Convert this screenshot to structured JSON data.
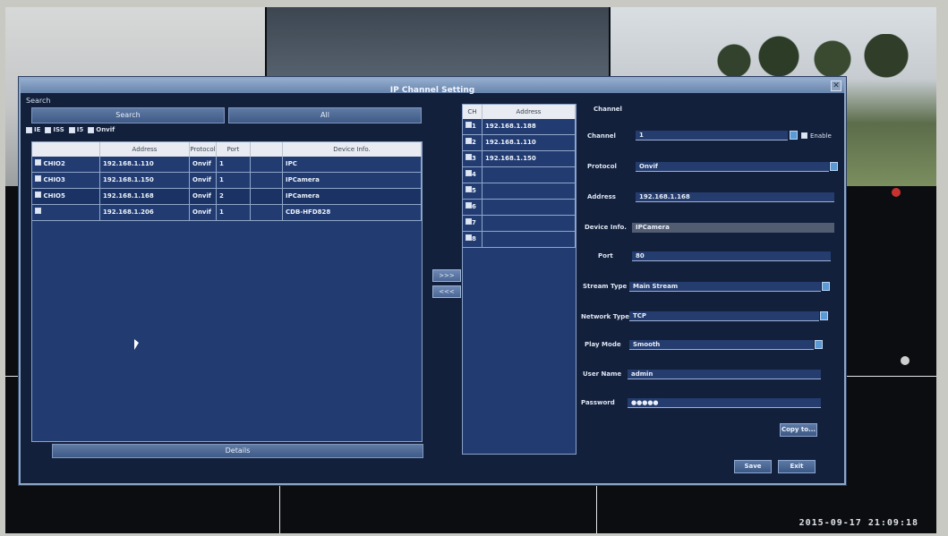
{
  "dialog": {
    "title": "IP Channel Setting",
    "close": "✕"
  },
  "search": {
    "section_label": "Search",
    "search_button": "Search",
    "all_button": "All",
    "filters": [
      {
        "label": "IE",
        "checked": true
      },
      {
        "label": "ISS",
        "checked": true
      },
      {
        "label": "I5",
        "checked": true
      },
      {
        "label": "Onvif",
        "checked": true
      }
    ],
    "columns": [
      "",
      "Address",
      "Protocol",
      "Port",
      "",
      "Device Info."
    ],
    "rows": [
      {
        "name": "CHIO2",
        "checked": true,
        "address": "192.168.1.110",
        "protocol": "Onvif",
        "port": "1",
        "info": "IPC"
      },
      {
        "name": "CHIO3",
        "checked": true,
        "address": "192.168.1.150",
        "protocol": "Onvif",
        "port": "1",
        "info": "IPCamera"
      },
      {
        "name": "CHIO5",
        "checked": true,
        "address": "192.168.1.168",
        "protocol": "Onvif",
        "port": "2",
        "info": "IPCamera"
      },
      {
        "name": "",
        "checked": false,
        "address": "192.168.1.206",
        "protocol": "Onvif",
        "port": "1",
        "info": "CDB-HFD828"
      }
    ],
    "details_button": "Details"
  },
  "transfer": {
    "add": ">>>",
    "remove": "<<<"
  },
  "channels": {
    "columns": [
      "CH",
      "Address"
    ],
    "rows": [
      {
        "ch": "1",
        "address": "192.168.1.188",
        "checked": true
      },
      {
        "ch": "2",
        "address": "192.168.1.110",
        "checked": true
      },
      {
        "ch": "3",
        "address": "192.168.1.150",
        "checked": true
      },
      {
        "ch": "4",
        "address": "",
        "checked": true
      },
      {
        "ch": "5",
        "address": "",
        "checked": true
      },
      {
        "ch": "6",
        "address": "",
        "checked": true
      },
      {
        "ch": "7",
        "address": "",
        "checked": true
      },
      {
        "ch": "8",
        "address": "",
        "checked": true
      }
    ]
  },
  "channel_form": {
    "heading": "Channel",
    "channel_label": "Channel",
    "channel_value": "1",
    "enable_label": "Enable",
    "protocol_label": "Protocol",
    "protocol_value": "Onvif",
    "address_label": "Address",
    "address_value": "192.168.1.168",
    "device_info_label": "Device Info.",
    "device_info_value": "IPCamera",
    "port_label": "Port",
    "port_value": "80",
    "stream_type_label": "Stream Type",
    "stream_type_value": "Main Stream",
    "network_type_label": "Network Type",
    "network_type_value": "TCP",
    "play_mode_label": "Play Mode",
    "play_mode_value": "Smooth",
    "user_name_label": "User Name",
    "user_name_value": "admin",
    "password_label": "Password",
    "password_value": "●●●●●",
    "copy_button": "Copy to...",
    "save_button": "Save",
    "exit_button": "Exit"
  },
  "status": {
    "timestamp": "2015-09-17 21:09:18"
  }
}
